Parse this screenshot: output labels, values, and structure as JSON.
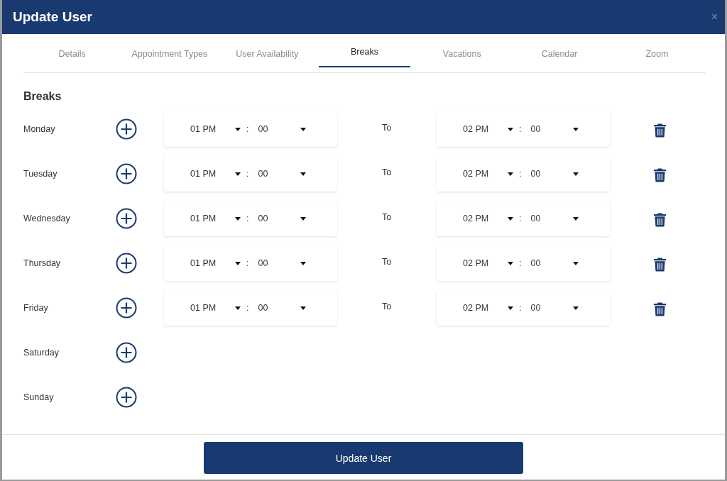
{
  "window": {
    "title": "Update User",
    "close": "×"
  },
  "tabs": [
    {
      "label": "Details",
      "selected": false
    },
    {
      "label": "Appointment Types",
      "selected": false
    },
    {
      "label": "User Availability",
      "selected": false
    },
    {
      "label": "Breaks",
      "selected": true
    },
    {
      "label": "Vacations",
      "selected": false
    },
    {
      "label": "Calendar",
      "selected": false
    },
    {
      "label": "Zoom",
      "selected": false
    }
  ],
  "section_title": "Breaks",
  "days": [
    {
      "day": "Monday",
      "from": {
        "hour": "01 PM",
        "minute": "00"
      },
      "to_label": "To",
      "to": {
        "hour": "02 PM",
        "minute": "00"
      }
    },
    {
      "day": "Tuesday",
      "from": {
        "hour": "01 PM",
        "minute": "00"
      },
      "to_label": "To",
      "to": {
        "hour": "02 PM",
        "minute": "00"
      }
    },
    {
      "day": "Wednesday",
      "from": {
        "hour": "01 PM",
        "minute": "00"
      },
      "to_label": "To",
      "to": {
        "hour": "02 PM",
        "minute": "00"
      }
    },
    {
      "day": "Thursday",
      "from": {
        "hour": "01 PM",
        "minute": "00"
      },
      "to_label": "To",
      "to": {
        "hour": "02 PM",
        "minute": "00"
      }
    },
    {
      "day": "Friday",
      "from": {
        "hour": "01 PM",
        "minute": "00"
      },
      "to_label": "To",
      "to": {
        "hour": "02 PM",
        "minute": "00"
      }
    },
    {
      "day": "Saturday"
    },
    {
      "day": "Sunday"
    }
  ],
  "separator": ":",
  "submit": "Update User"
}
